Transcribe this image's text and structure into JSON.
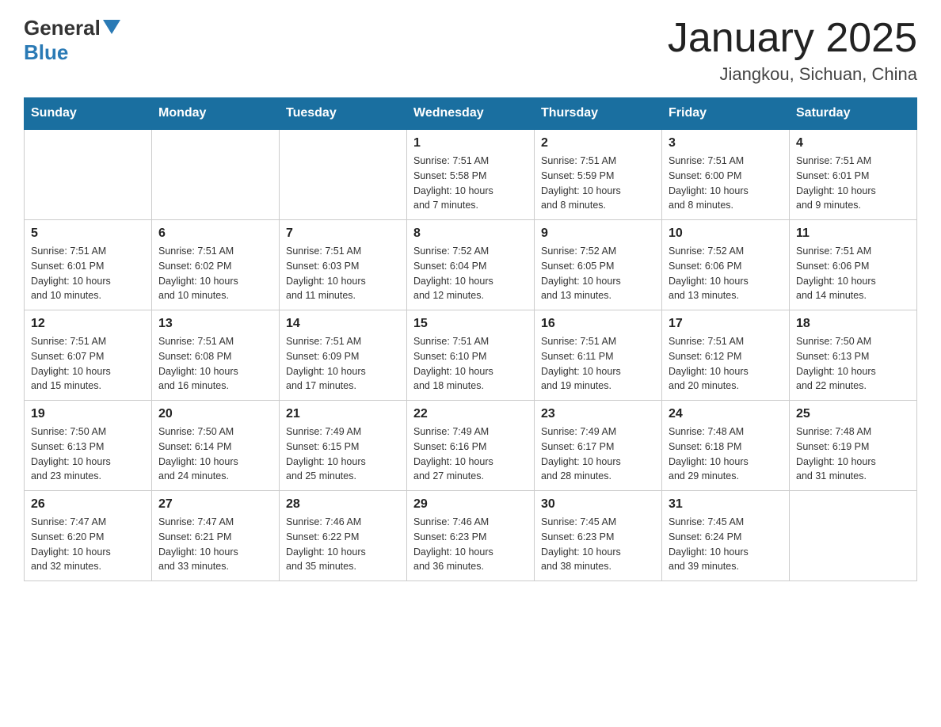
{
  "header": {
    "logo": {
      "general": "General",
      "blue": "Blue"
    },
    "title": "January 2025",
    "subtitle": "Jiangkou, Sichuan, China"
  },
  "weekdays": [
    "Sunday",
    "Monday",
    "Tuesday",
    "Wednesday",
    "Thursday",
    "Friday",
    "Saturday"
  ],
  "weeks": [
    [
      {
        "day": "",
        "info": ""
      },
      {
        "day": "",
        "info": ""
      },
      {
        "day": "",
        "info": ""
      },
      {
        "day": "1",
        "info": "Sunrise: 7:51 AM\nSunset: 5:58 PM\nDaylight: 10 hours\nand 7 minutes."
      },
      {
        "day": "2",
        "info": "Sunrise: 7:51 AM\nSunset: 5:59 PM\nDaylight: 10 hours\nand 8 minutes."
      },
      {
        "day": "3",
        "info": "Sunrise: 7:51 AM\nSunset: 6:00 PM\nDaylight: 10 hours\nand 8 minutes."
      },
      {
        "day": "4",
        "info": "Sunrise: 7:51 AM\nSunset: 6:01 PM\nDaylight: 10 hours\nand 9 minutes."
      }
    ],
    [
      {
        "day": "5",
        "info": "Sunrise: 7:51 AM\nSunset: 6:01 PM\nDaylight: 10 hours\nand 10 minutes."
      },
      {
        "day": "6",
        "info": "Sunrise: 7:51 AM\nSunset: 6:02 PM\nDaylight: 10 hours\nand 10 minutes."
      },
      {
        "day": "7",
        "info": "Sunrise: 7:51 AM\nSunset: 6:03 PM\nDaylight: 10 hours\nand 11 minutes."
      },
      {
        "day": "8",
        "info": "Sunrise: 7:52 AM\nSunset: 6:04 PM\nDaylight: 10 hours\nand 12 minutes."
      },
      {
        "day": "9",
        "info": "Sunrise: 7:52 AM\nSunset: 6:05 PM\nDaylight: 10 hours\nand 13 minutes."
      },
      {
        "day": "10",
        "info": "Sunrise: 7:52 AM\nSunset: 6:06 PM\nDaylight: 10 hours\nand 13 minutes."
      },
      {
        "day": "11",
        "info": "Sunrise: 7:51 AM\nSunset: 6:06 PM\nDaylight: 10 hours\nand 14 minutes."
      }
    ],
    [
      {
        "day": "12",
        "info": "Sunrise: 7:51 AM\nSunset: 6:07 PM\nDaylight: 10 hours\nand 15 minutes."
      },
      {
        "day": "13",
        "info": "Sunrise: 7:51 AM\nSunset: 6:08 PM\nDaylight: 10 hours\nand 16 minutes."
      },
      {
        "day": "14",
        "info": "Sunrise: 7:51 AM\nSunset: 6:09 PM\nDaylight: 10 hours\nand 17 minutes."
      },
      {
        "day": "15",
        "info": "Sunrise: 7:51 AM\nSunset: 6:10 PM\nDaylight: 10 hours\nand 18 minutes."
      },
      {
        "day": "16",
        "info": "Sunrise: 7:51 AM\nSunset: 6:11 PM\nDaylight: 10 hours\nand 19 minutes."
      },
      {
        "day": "17",
        "info": "Sunrise: 7:51 AM\nSunset: 6:12 PM\nDaylight: 10 hours\nand 20 minutes."
      },
      {
        "day": "18",
        "info": "Sunrise: 7:50 AM\nSunset: 6:13 PM\nDaylight: 10 hours\nand 22 minutes."
      }
    ],
    [
      {
        "day": "19",
        "info": "Sunrise: 7:50 AM\nSunset: 6:13 PM\nDaylight: 10 hours\nand 23 minutes."
      },
      {
        "day": "20",
        "info": "Sunrise: 7:50 AM\nSunset: 6:14 PM\nDaylight: 10 hours\nand 24 minutes."
      },
      {
        "day": "21",
        "info": "Sunrise: 7:49 AM\nSunset: 6:15 PM\nDaylight: 10 hours\nand 25 minutes."
      },
      {
        "day": "22",
        "info": "Sunrise: 7:49 AM\nSunset: 6:16 PM\nDaylight: 10 hours\nand 27 minutes."
      },
      {
        "day": "23",
        "info": "Sunrise: 7:49 AM\nSunset: 6:17 PM\nDaylight: 10 hours\nand 28 minutes."
      },
      {
        "day": "24",
        "info": "Sunrise: 7:48 AM\nSunset: 6:18 PM\nDaylight: 10 hours\nand 29 minutes."
      },
      {
        "day": "25",
        "info": "Sunrise: 7:48 AM\nSunset: 6:19 PM\nDaylight: 10 hours\nand 31 minutes."
      }
    ],
    [
      {
        "day": "26",
        "info": "Sunrise: 7:47 AM\nSunset: 6:20 PM\nDaylight: 10 hours\nand 32 minutes."
      },
      {
        "day": "27",
        "info": "Sunrise: 7:47 AM\nSunset: 6:21 PM\nDaylight: 10 hours\nand 33 minutes."
      },
      {
        "day": "28",
        "info": "Sunrise: 7:46 AM\nSunset: 6:22 PM\nDaylight: 10 hours\nand 35 minutes."
      },
      {
        "day": "29",
        "info": "Sunrise: 7:46 AM\nSunset: 6:23 PM\nDaylight: 10 hours\nand 36 minutes."
      },
      {
        "day": "30",
        "info": "Sunrise: 7:45 AM\nSunset: 6:23 PM\nDaylight: 10 hours\nand 38 minutes."
      },
      {
        "day": "31",
        "info": "Sunrise: 7:45 AM\nSunset: 6:24 PM\nDaylight: 10 hours\nand 39 minutes."
      },
      {
        "day": "",
        "info": ""
      }
    ]
  ]
}
